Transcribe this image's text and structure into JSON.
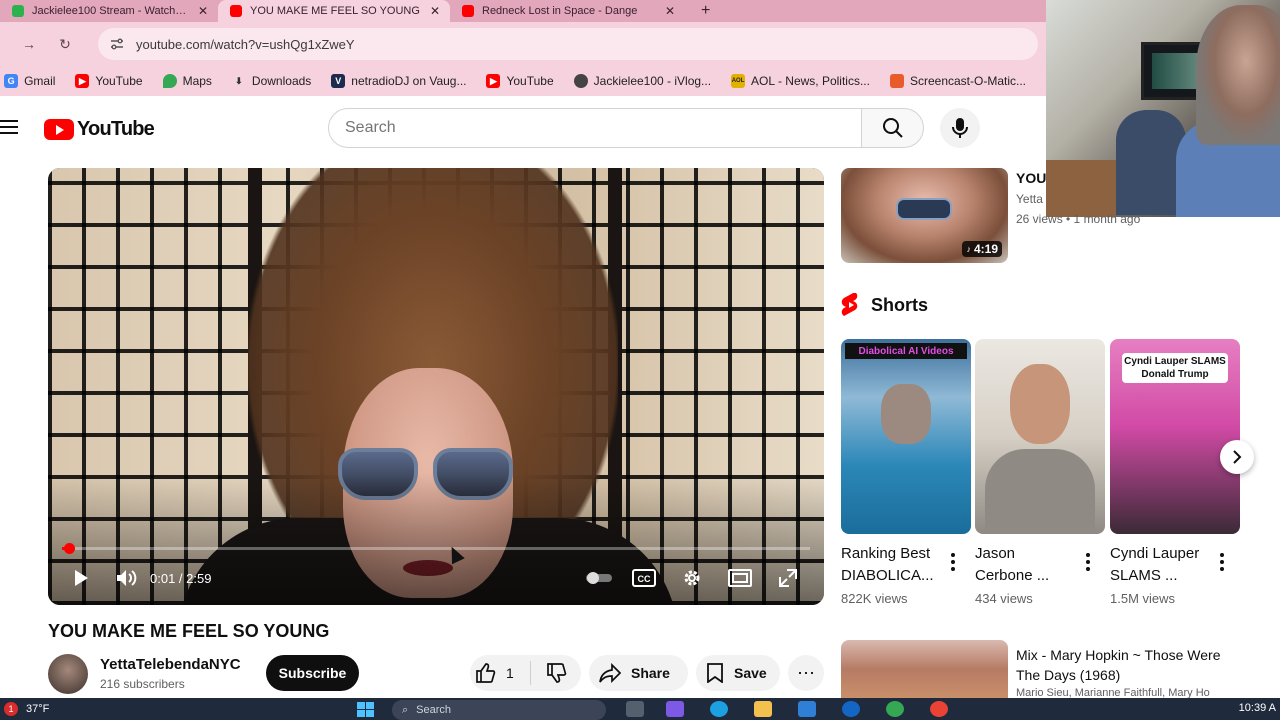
{
  "browser": {
    "tabs": [
      {
        "title": "Jackielee100 Stream - Watch Liv",
        "favicon_color": "#2bb24c",
        "active": false
      },
      {
        "title": "YOU MAKE ME FEEL SO YOUNG",
        "favicon_color": "#ff0000",
        "active": true
      },
      {
        "title": "Redneck Lost in Space - Dange",
        "favicon_color": "#ff0000",
        "active": false
      }
    ],
    "new_tab_label": "+",
    "url": "youtube.com/watch?v=ushQg1xZweY",
    "bookmarks": [
      {
        "label": "Gmail",
        "icon": "google-icon",
        "color": "#4285f4"
      },
      {
        "label": "YouTube",
        "icon": "youtube-icon",
        "color": "#ff0000"
      },
      {
        "label": "Maps",
        "icon": "maps-pin-icon",
        "color": "#34a853"
      },
      {
        "label": "Downloads",
        "icon": "download-icon",
        "color": "#333333"
      },
      {
        "label": "netradioDJ on Vaug...",
        "icon": "vaughn-icon",
        "color": "#1d2b4f"
      },
      {
        "label": "YouTube",
        "icon": "youtube-icon",
        "color": "#ff0000"
      },
      {
        "label": "Jackielee100 - iVlog...",
        "icon": "ivlog-icon",
        "color": "#444444"
      },
      {
        "label": "AOL - News, Politics...",
        "icon": "aol-icon",
        "color": "#e2b100"
      },
      {
        "label": "Screencast-O-Matic...",
        "icon": "screencast-icon",
        "color": "#e85c2b"
      }
    ]
  },
  "youtube": {
    "logo_text": "YouTube",
    "search_placeholder": "Search",
    "player": {
      "time_label": "0:01 / 2:59",
      "progress": 0.006
    },
    "video": {
      "title": "YOU MAKE ME FEEL SO YOUNG",
      "channel": "YettaTelebendaNYC",
      "subscribers": "216 subscribers",
      "subscribe_label": "Subscribe",
      "likes": "1",
      "share_label": "Share",
      "save_label": "Save"
    },
    "recommended": {
      "title": "YOU",
      "channel": "Yetta",
      "meta": "26 views • 1 month ago",
      "duration": "4:19"
    },
    "shorts": {
      "heading": "Shorts",
      "items": [
        {
          "title_line1": "Ranking Best",
          "title_line2": "DIABOLICA...",
          "views": "822K views",
          "overlay": "Diabolical AI Videos"
        },
        {
          "title_line1": "Jason",
          "title_line2": "Cerbone ...",
          "views": "434 views",
          "overlay": ""
        },
        {
          "title_line1": "Cyndi Lauper",
          "title_line2": "SLAMS ...",
          "views": "1.5M views",
          "overlay": "Cyndi Lauper SLAMS Donald Trump"
        }
      ]
    },
    "mix": {
      "title": "Mix - Mary Hopkin ~ Those Were The Days (1968)",
      "subtitle": "Mario Sieu, Marianne Faithfull, Mary Ho"
    }
  },
  "taskbar": {
    "weather_badge": "1",
    "temperature": "37°F",
    "search_placeholder": "Search",
    "clock": "10:39 A"
  }
}
